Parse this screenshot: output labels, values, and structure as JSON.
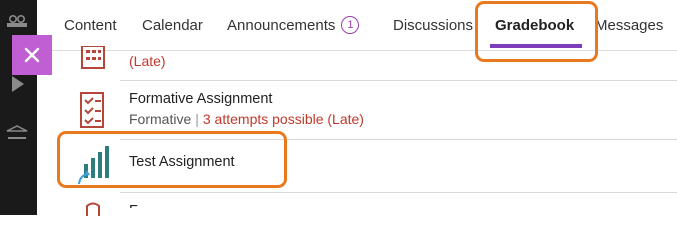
{
  "tabs": [
    {
      "label": "Content"
    },
    {
      "label": "Calendar"
    },
    {
      "label": "Announcements",
      "badge": "1"
    },
    {
      "label": "Discussions"
    },
    {
      "label": "Gradebook",
      "active": true
    },
    {
      "label": "Messages"
    }
  ],
  "items": [
    {
      "subtitle_late": "(Late)",
      "icon": "document-grid-icon"
    },
    {
      "title": "Formative Assignment",
      "subtitle_type": "Formative",
      "subtitle_separator": "|",
      "subtitle_attempts": "3 attempts possible (Late)",
      "icon": "checklist-icon"
    },
    {
      "title": "Test Assignment",
      "icon": "chart-bars-icon"
    },
    {
      "title": "F...",
      "icon": "document-icon"
    }
  ],
  "colors": {
    "accent": "#7e3ebb",
    "close_button": "#c05fd3",
    "late": "#c0392b",
    "highlight": "#e8791f"
  }
}
